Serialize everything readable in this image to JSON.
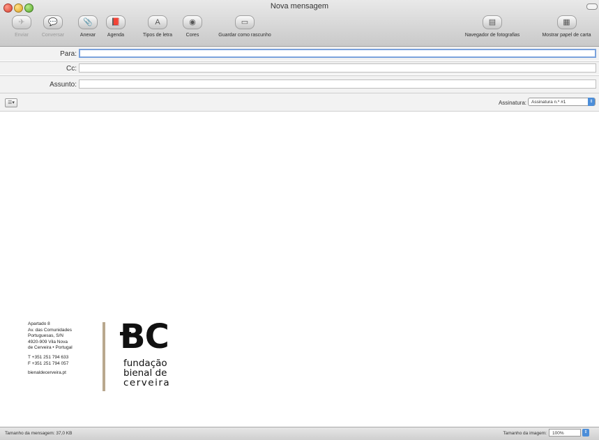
{
  "window": {
    "title": "Nova mensagem"
  },
  "toolbar": {
    "items": [
      {
        "label": "Enviar",
        "icon": "send-icon",
        "glyph": "✈",
        "enabled": false
      },
      {
        "label": "Conversar",
        "icon": "chat-icon",
        "glyph": "💬",
        "enabled": false
      },
      {
        "label": "Anexar",
        "icon": "paperclip-icon",
        "glyph": "📎",
        "enabled": true
      },
      {
        "label": "Agenda",
        "icon": "address-book-icon",
        "glyph": "📕",
        "enabled": true
      },
      {
        "label": "Tipos de letra",
        "icon": "font-icon",
        "glyph": "A",
        "enabled": true
      },
      {
        "label": "Cores",
        "icon": "color-wheel-icon",
        "glyph": "◉",
        "enabled": true
      },
      {
        "label": "Guardar como rascunho",
        "icon": "draft-icon",
        "glyph": "▭",
        "enabled": true
      },
      {
        "label": "Navegador de fotografias",
        "icon": "photo-browser-icon",
        "glyph": "▤",
        "enabled": true
      },
      {
        "label": "Mostrar papel de carta",
        "icon": "stationery-icon",
        "glyph": "▦",
        "enabled": true
      }
    ]
  },
  "header": {
    "to_label": "Para:",
    "to_value": "",
    "cc_label": "Cc:",
    "cc_value": "",
    "subject_label": "Assunto:",
    "subject_value": "",
    "options_glyph": "☰▾",
    "signature_label": "Assinatura:",
    "signature_value": "Assinatura n.º #1"
  },
  "signature": {
    "address_lines": [
      "Apartado 8",
      "Av. das Comunidades",
      "Portuguesas, S/N",
      "4920-909  Vila Nova",
      "de Cerveira • Portugal"
    ],
    "phone_lines": [
      "T +351 251 794 633",
      "F +351 251 794 057"
    ],
    "website": "bienaldecerveira.pt",
    "logo_letters": "BC",
    "logo_lines": [
      "fundação",
      "bienal de",
      "cerveira"
    ]
  },
  "status": {
    "message_size": "Tamanho da mensagem:  37,0 KB",
    "image_size_label": "Tamanho da imagem:",
    "image_size_value": "100%"
  },
  "colors": {
    "accent": "#4c8ed9",
    "signature_bar": "#b9a88e"
  }
}
